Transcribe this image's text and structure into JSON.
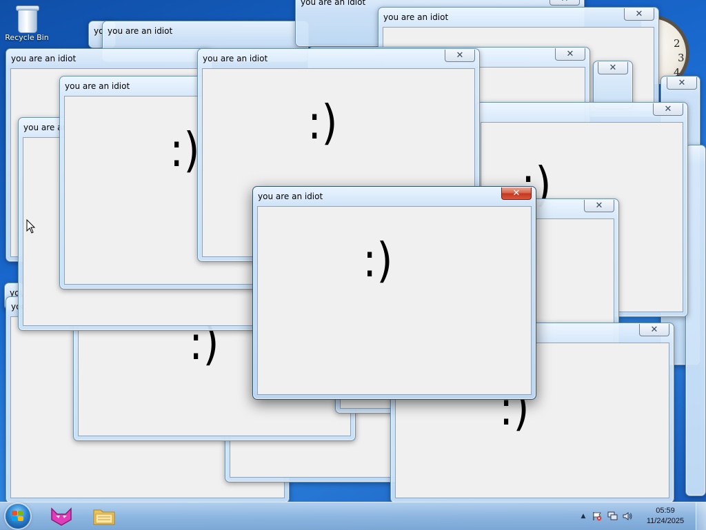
{
  "desktop": {
    "recycle_bin_label": "Recycle Bin",
    "clock_gadget_numbers": [
      "2",
      "3",
      "4"
    ]
  },
  "window_title": "you are an idiot",
  "smiley_text": ":)",
  "close_glyph": "✕",
  "taskbar": {
    "apps": [
      {
        "name": "start-button",
        "icon": "windows-flag-icon"
      },
      {
        "name": "taskbar-app-cat",
        "icon": "pink-cat-icon"
      },
      {
        "name": "taskbar-app-explorer",
        "icon": "folder-icon"
      }
    ],
    "tray": {
      "show_hidden_glyph": "▲",
      "time": "05:59",
      "date": "11/24/2025"
    }
  },
  "colors": {
    "active_close": "#c3361d",
    "client_bg": "#f0f0f0",
    "desktop_bg": "#1a6ad0"
  }
}
